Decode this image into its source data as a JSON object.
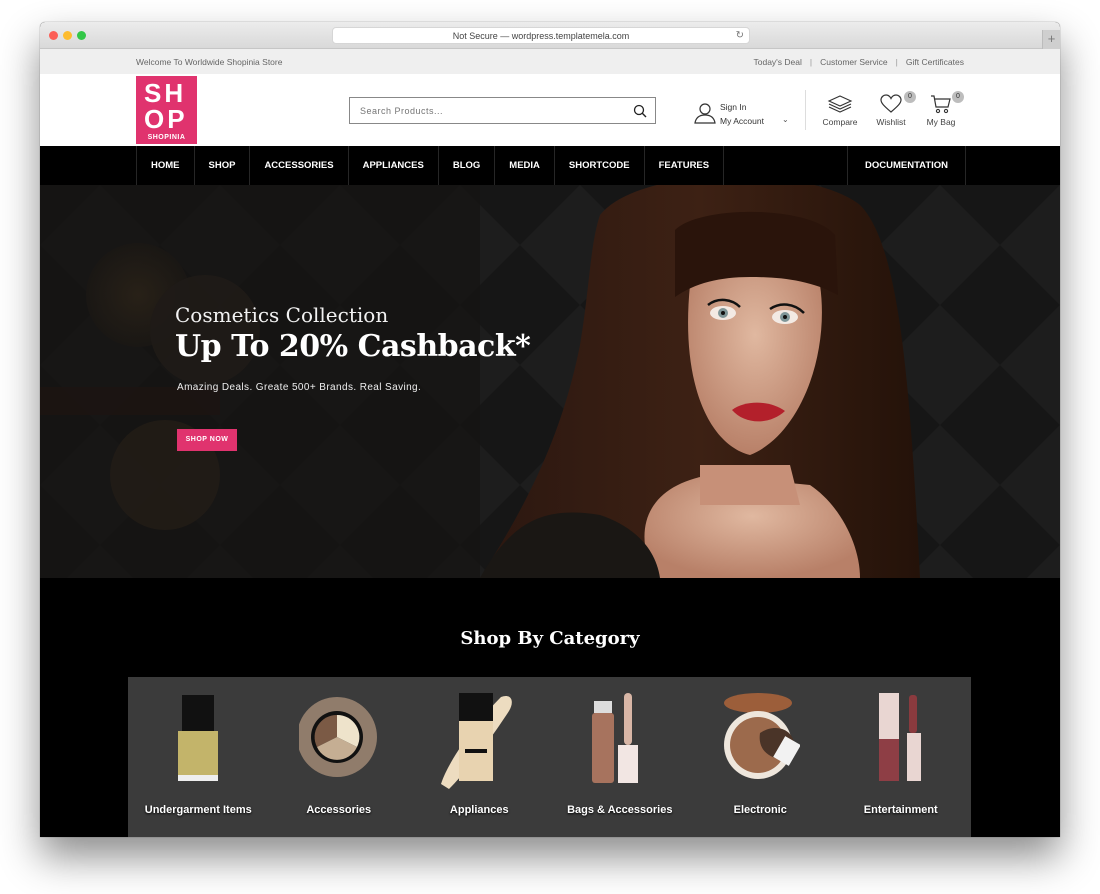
{
  "browser": {
    "url_text": "Not Secure — wordpress.templatemela.com",
    "reload_icon": "reload-icon",
    "newtab_symbol": "+"
  },
  "topbar": {
    "welcome": "Welcome To Worldwide Shopinia Store",
    "links": [
      "Today's Deal",
      "Customer Service",
      "Gift Certificates"
    ],
    "separator": "|"
  },
  "header": {
    "logo": {
      "line1": "SH",
      "line2": "OP",
      "brand": "SHOPINIA",
      "color": "#e0336e"
    },
    "search": {
      "placeholder": "Search Products...",
      "value": ""
    },
    "account": {
      "sign_in": "Sign In",
      "my_account": "My Account",
      "chevron": "⌄"
    },
    "compare_label": "Compare",
    "wishlist_label": "Wishlist",
    "wishlist_count": "0",
    "bag_label": "My Bag",
    "bag_count": "0"
  },
  "nav": {
    "items": [
      "HOME",
      "SHOP",
      "ACCESSORIES",
      "APPLIANCES",
      "BLOG",
      "MEDIA",
      "SHORTCODE",
      "FEATURES"
    ],
    "right_item": "DOCUMENTATION"
  },
  "hero": {
    "subtitle": "Cosmetics Collection",
    "title": "Up To 20% Cashback*",
    "description": "Amazing Deals. Greate 500+ Brands. Real Saving.",
    "button": "SHOP NOW",
    "accent": "#e0336e"
  },
  "categories": {
    "title": "Shop By Category",
    "items": [
      {
        "name": "Undergarment Items",
        "image": "nail-polish"
      },
      {
        "name": "Accessories",
        "image": "eyeshadow-palette"
      },
      {
        "name": "Appliances",
        "image": "foundation-bottle"
      },
      {
        "name": "Bags & Accessories",
        "image": "lip-gloss"
      },
      {
        "name": "Electronic",
        "image": "bronzer-compact"
      },
      {
        "name": "Entertainment",
        "image": "liquid-lipstick"
      }
    ]
  }
}
